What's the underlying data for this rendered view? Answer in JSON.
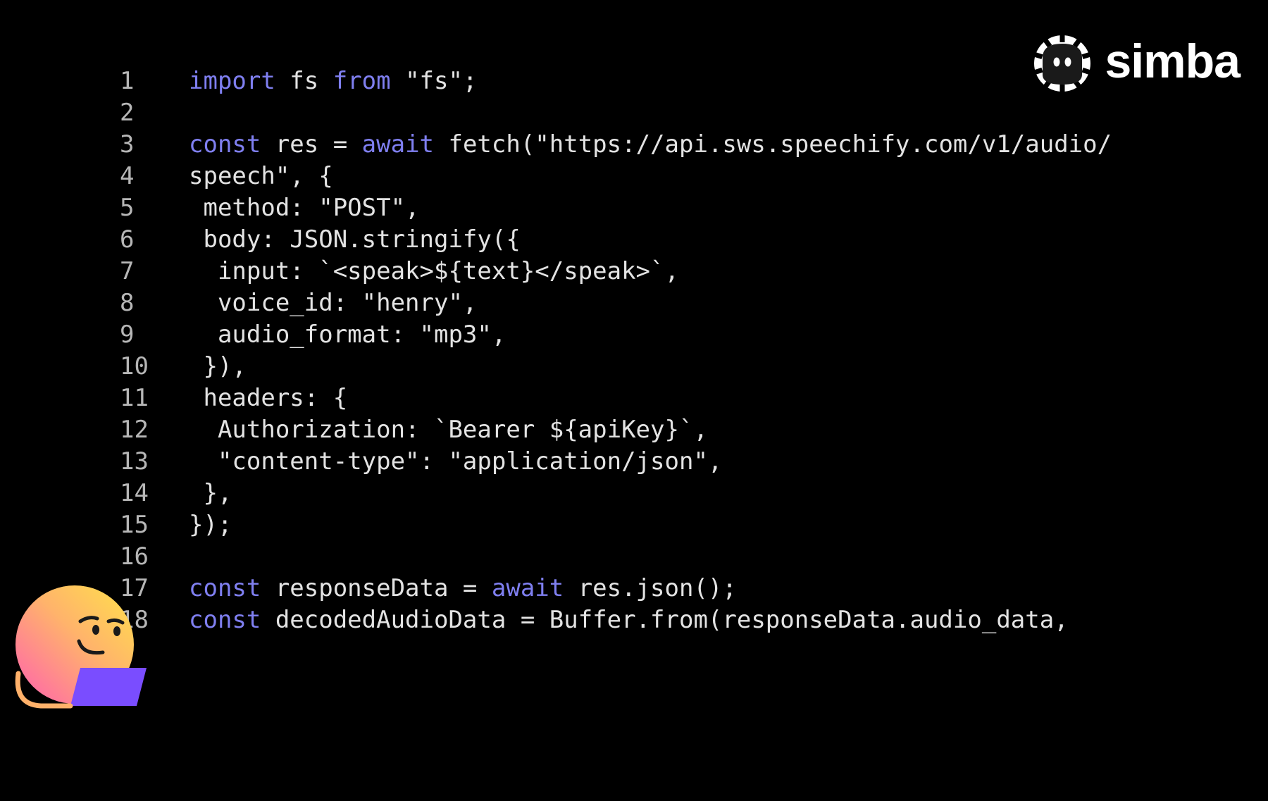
{
  "brand": {
    "name": "simba",
    "icon": "simba-logo-icon"
  },
  "colors": {
    "background": "#000000",
    "keyword": "#7f7ff0",
    "text": "#e3e3e3",
    "line_number": "#b6b6b6"
  },
  "code": {
    "lines": [
      {
        "num": "1",
        "tokens": [
          {
            "t": "import",
            "k": "kw"
          },
          {
            "t": " fs ",
            "k": "plain"
          },
          {
            "t": "from",
            "k": "kw"
          },
          {
            "t": " \"fs\";",
            "k": "plain"
          }
        ]
      },
      {
        "num": "2",
        "tokens": []
      },
      {
        "num": "3",
        "tokens": [
          {
            "t": "const",
            "k": "kw"
          },
          {
            "t": " res = ",
            "k": "plain"
          },
          {
            "t": "await",
            "k": "kw"
          },
          {
            "t": " fetch(\"https://api.sws.speechify.com/v1/audio/",
            "k": "plain"
          }
        ]
      },
      {
        "num": "4",
        "tokens": [
          {
            "t": "speech\", {",
            "k": "plain"
          }
        ]
      },
      {
        "num": "5",
        "tokens": [
          {
            "t": " method: \"POST\",",
            "k": "plain"
          }
        ]
      },
      {
        "num": "6",
        "tokens": [
          {
            "t": " body: JSON.stringify({",
            "k": "plain"
          }
        ]
      },
      {
        "num": "7",
        "tokens": [
          {
            "t": "  input: `<speak>${text}</speak>`,",
            "k": "plain"
          }
        ]
      },
      {
        "num": "8",
        "tokens": [
          {
            "t": "  voice_id: \"henry\",",
            "k": "plain"
          }
        ]
      },
      {
        "num": "9",
        "tokens": [
          {
            "t": "  audio_format: \"mp3\",",
            "k": "plain"
          }
        ]
      },
      {
        "num": "10",
        "tokens": [
          {
            "t": " }),",
            "k": "plain"
          }
        ]
      },
      {
        "num": "11",
        "tokens": [
          {
            "t": " headers: {",
            "k": "plain"
          }
        ]
      },
      {
        "num": "12",
        "tokens": [
          {
            "t": "  Authorization: `Bearer ${apiKey}`,",
            "k": "plain"
          }
        ]
      },
      {
        "num": "13",
        "tokens": [
          {
            "t": "  \"content-type\": \"application/json\",",
            "k": "plain"
          }
        ]
      },
      {
        "num": "14",
        "tokens": [
          {
            "t": " },",
            "k": "plain"
          }
        ]
      },
      {
        "num": "15",
        "tokens": [
          {
            "t": "});",
            "k": "plain"
          }
        ]
      },
      {
        "num": "16",
        "tokens": []
      },
      {
        "num": "17",
        "tokens": [
          {
            "t": "const",
            "k": "kw"
          },
          {
            "t": " responseData = ",
            "k": "plain"
          },
          {
            "t": "await",
            "k": "kw"
          },
          {
            "t": " res.json();",
            "k": "plain"
          }
        ]
      },
      {
        "num": "18",
        "tokens": [
          {
            "t": "const",
            "k": "kw"
          },
          {
            "t": " decodedAudioData = Buffer.from(responseData.audio_data,",
            "k": "plain"
          }
        ]
      }
    ]
  },
  "mascot": {
    "icon": "thinking-emoji-with-laptop-icon"
  }
}
